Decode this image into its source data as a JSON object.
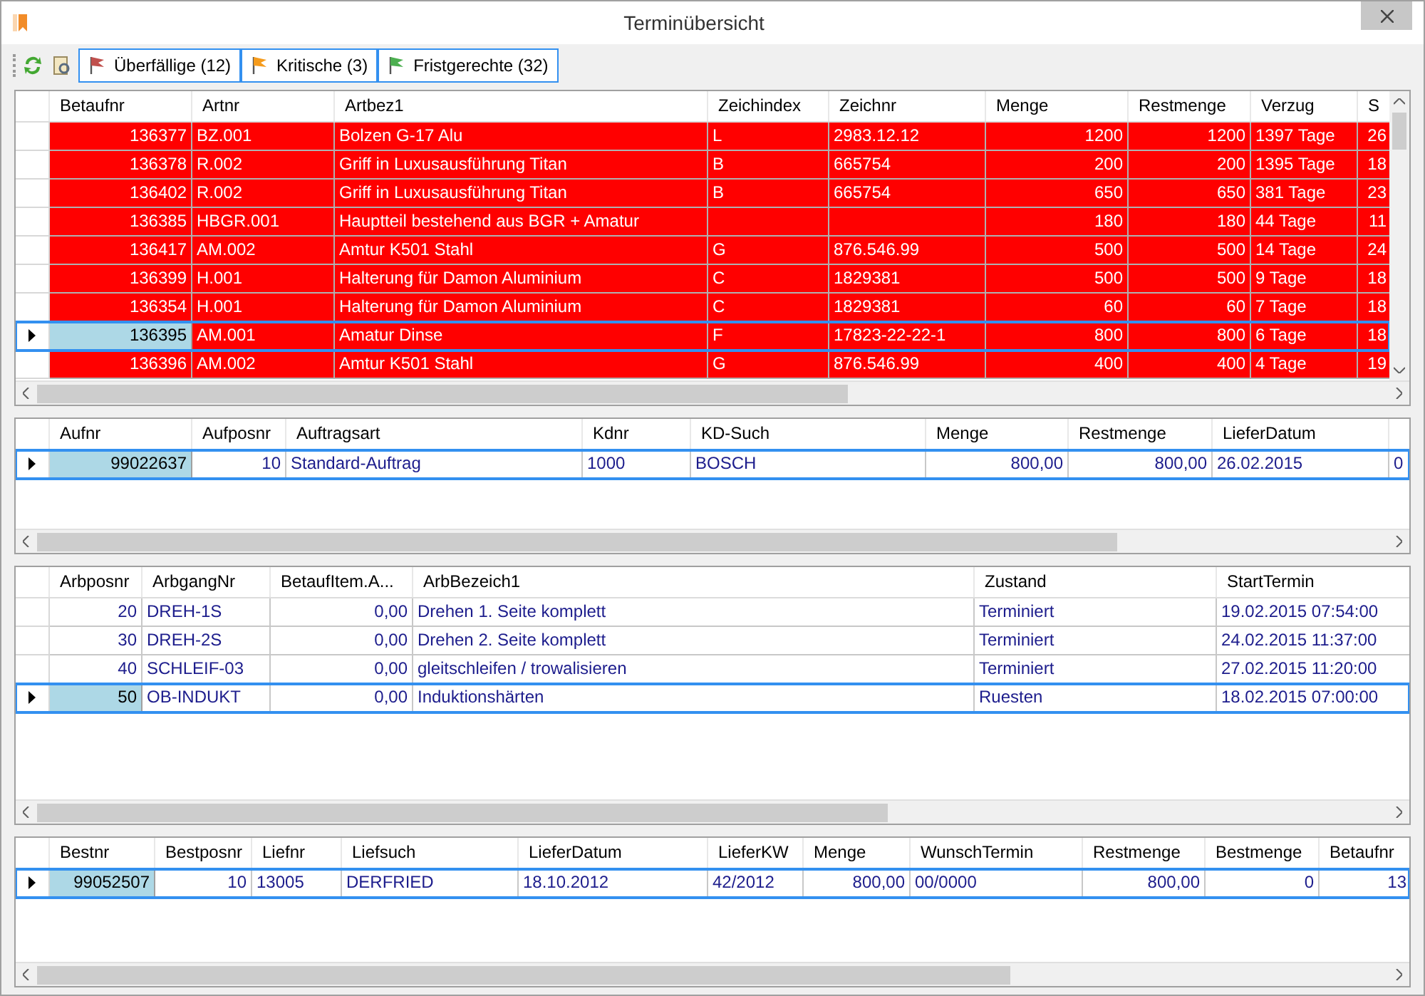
{
  "window": {
    "title": "Terminübersicht"
  },
  "toolbar": {
    "filters": [
      {
        "label": "Überfällige (12)",
        "color": "#c0504d"
      },
      {
        "label": "Kritische (3)",
        "color": "#f59b1c"
      },
      {
        "label": "Fristgerechte (32)",
        "color": "#4caf50"
      }
    ]
  },
  "grids": [
    {
      "columns": [
        {
          "label": "Betaufnr"
        },
        {
          "label": "Artnr"
        },
        {
          "label": "Artbez1"
        },
        {
          "label": "Zeichindex"
        },
        {
          "label": "Zeichnr"
        },
        {
          "label": "Menge"
        },
        {
          "label": "Restmenge"
        },
        {
          "label": "Verzug"
        },
        {
          "label": "S"
        }
      ],
      "rows": [
        {
          "kind": "overdue",
          "selected": false,
          "cells": [
            "136377",
            "BZ.001",
            "Bolzen G-17 Alu",
            "L",
            "2983.12.12",
            "1200",
            "1200",
            "1397 Tage",
            "26"
          ]
        },
        {
          "kind": "overdue",
          "selected": false,
          "cells": [
            "136378",
            "R.002",
            "Griff in Luxusausführung Titan",
            "B",
            "665754",
            "200",
            "200",
            "1395 Tage",
            "18"
          ]
        },
        {
          "kind": "overdue",
          "selected": false,
          "cells": [
            "136402",
            "R.002",
            "Griff in Luxusausführung Titan",
            "B",
            "665754",
            "650",
            "650",
            "381 Tage",
            "23"
          ]
        },
        {
          "kind": "overdue",
          "selected": false,
          "cells": [
            "136385",
            "HBGR.001",
            "Hauptteil bestehend aus BGR + Amatur",
            null,
            null,
            "180",
            "180",
            "44 Tage",
            "11"
          ]
        },
        {
          "kind": "overdue",
          "selected": false,
          "cells": [
            "136417",
            "AM.002",
            "Amtur K501 Stahl",
            "G",
            "876.546.99",
            "500",
            "500",
            "14 Tage",
            "24"
          ]
        },
        {
          "kind": "overdue",
          "selected": false,
          "cells": [
            "136399",
            "H.001",
            "Halterung für Damon Aluminium",
            "C",
            "1829381",
            "500",
            "500",
            "9 Tage",
            "18"
          ]
        },
        {
          "kind": "overdue",
          "selected": false,
          "cells": [
            "136354",
            "H.001",
            "Halterung für Damon Aluminium",
            "C",
            "1829381",
            "60",
            "60",
            "7 Tage",
            "18"
          ]
        },
        {
          "kind": "overdue",
          "selected": true,
          "cells": [
            "136395",
            "AM.001",
            "Amatur Dinse",
            "F",
            "17823-22-22-1",
            "800",
            "800",
            "6 Tage",
            "18"
          ]
        },
        {
          "kind": "overdue",
          "selected": false,
          "cells": [
            "136396",
            "AM.002",
            "Amtur K501 Stahl",
            "G",
            "876.546.99",
            "400",
            "400",
            "4 Tage",
            "19"
          ]
        }
      ]
    },
    {
      "columns": [
        {
          "label": "Aufnr"
        },
        {
          "label": "Aufposnr"
        },
        {
          "label": "Auftragsart"
        },
        {
          "label": "Kdnr"
        },
        {
          "label": "KD-Such"
        },
        {
          "label": "Menge"
        },
        {
          "label": "Restmenge"
        },
        {
          "label": "LieferDatum"
        },
        {}
      ],
      "rows": [
        {
          "kind": "normal",
          "selected": true,
          "cells": [
            "99022637",
            "10",
            "Standard-Auftrag",
            "1000",
            "BOSCH",
            "800,00",
            "800,00",
            "26.02.2015",
            "0"
          ]
        }
      ]
    },
    {
      "columns": [
        {
          "label": "Arbposnr"
        },
        {
          "label": "ArbgangNr"
        },
        {
          "label": "BetaufItem.A..."
        },
        {
          "label": "ArbBezeich1"
        },
        {
          "label": "Zustand"
        },
        {
          "label": "StartTermin"
        }
      ],
      "rows": [
        {
          "kind": "normal",
          "selected": false,
          "cells": [
            "20",
            "DREH-1S",
            "0,00",
            "Drehen 1. Seite komplett",
            "Terminiert",
            "19.02.2015 07:54:00"
          ]
        },
        {
          "kind": "normal",
          "selected": false,
          "cells": [
            "30",
            "DREH-2S",
            "0,00",
            "Drehen 2. Seite komplett",
            "Terminiert",
            "24.02.2015 11:37:00"
          ]
        },
        {
          "kind": "normal",
          "selected": false,
          "cells": [
            "40",
            "SCHLEIF-03",
            "0,00",
            "gleitschleifen / trowalisieren",
            "Terminiert",
            "27.02.2015 11:20:00"
          ]
        },
        {
          "kind": "normal",
          "selected": true,
          "cells": [
            "50",
            "OB-INDUKT",
            "0,00",
            "Induktionshärten",
            "Ruesten",
            "18.02.2015 07:00:00"
          ]
        }
      ]
    },
    {
      "columns": [
        {
          "label": "Bestnr"
        },
        {
          "label": "Bestposnr"
        },
        {
          "label": "Liefnr"
        },
        {
          "label": "Liefsuch"
        },
        {
          "label": "LieferDatum"
        },
        {
          "label": "LieferKW"
        },
        {
          "label": "Menge"
        },
        {
          "label": "WunschTermin"
        },
        {
          "label": "Restmenge"
        },
        {
          "label": "Bestmenge"
        },
        {
          "label": "Betaufnr"
        }
      ],
      "rows": [
        {
          "kind": "normal",
          "selected": true,
          "cells": [
            "99052507",
            "10",
            "13005",
            "DERFRIED",
            "18.10.2012",
            "42/2012",
            "800,00",
            "00/0000",
            "800,00",
            "0",
            "13"
          ]
        }
      ]
    }
  ]
}
